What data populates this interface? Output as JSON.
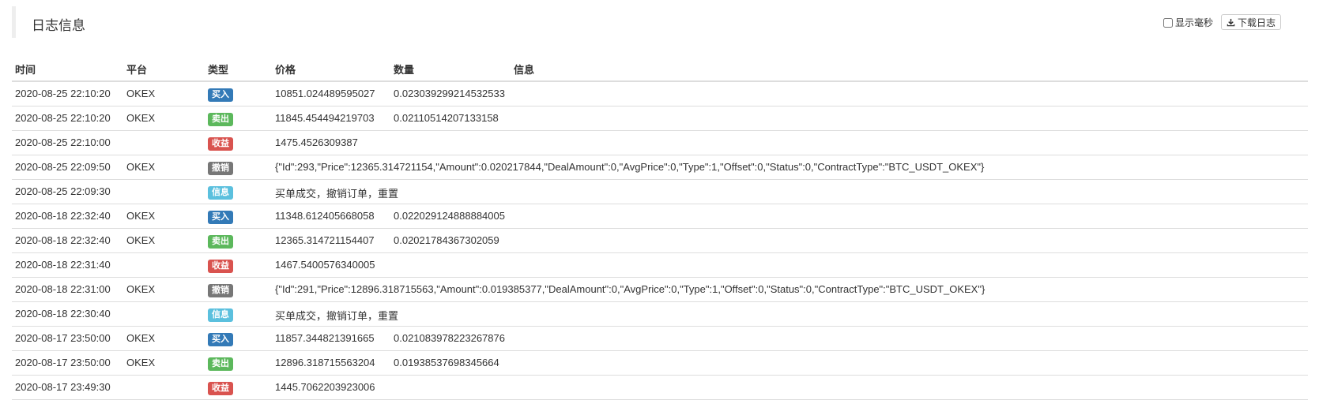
{
  "panel": {
    "title": "日志信息",
    "show_ms_label": "显示毫秒",
    "download_label": "下载日志"
  },
  "columns": {
    "time": "时间",
    "platform": "平台",
    "type": "类型",
    "price": "价格",
    "amount": "数量",
    "info": "信息"
  },
  "rows": [
    {
      "time": "2020-08-25 22:10:20",
      "platform": "OKEX",
      "type": "买入",
      "type_kind": "buy",
      "price": "10851.024489595027",
      "amount": "0.023039299214532533",
      "info": ""
    },
    {
      "time": "2020-08-25 22:10:20",
      "platform": "OKEX",
      "type": "卖出",
      "type_kind": "sell",
      "price": "11845.454494219703",
      "amount": "0.02110514207133158",
      "info": ""
    },
    {
      "time": "2020-08-25 22:10:00",
      "platform": "",
      "type": "收益",
      "type_kind": "profit",
      "price": "1475.4526309387",
      "amount": "",
      "info": ""
    },
    {
      "time": "2020-08-25 22:09:50",
      "platform": "OKEX",
      "type": "撤销",
      "type_kind": "cancel",
      "price": "{\"Id\":293,\"Price\":12365.314721154,\"Amount\":0.020217844,\"DealAmount\":0,\"AvgPrice\":0,\"Type\":1,\"Offset\":0,\"Status\":0,\"ContractType\":\"BTC_USDT_OKEX\"}",
      "amount": "",
      "info": ""
    },
    {
      "time": "2020-08-25 22:09:30",
      "platform": "",
      "type": "信息",
      "type_kind": "info",
      "price": "买单成交，撤销订单，重置",
      "amount": "",
      "info": ""
    },
    {
      "time": "2020-08-18 22:32:40",
      "platform": "OKEX",
      "type": "买入",
      "type_kind": "buy",
      "price": "11348.612405668058",
      "amount": "0.022029124888884005",
      "info": ""
    },
    {
      "time": "2020-08-18 22:32:40",
      "platform": "OKEX",
      "type": "卖出",
      "type_kind": "sell",
      "price": "12365.314721154407",
      "amount": "0.02021784367302059",
      "info": ""
    },
    {
      "time": "2020-08-18 22:31:40",
      "platform": "",
      "type": "收益",
      "type_kind": "profit",
      "price": "1467.5400576340005",
      "amount": "",
      "info": ""
    },
    {
      "time": "2020-08-18 22:31:00",
      "platform": "OKEX",
      "type": "撤销",
      "type_kind": "cancel",
      "price": "{\"Id\":291,\"Price\":12896.318715563,\"Amount\":0.019385377,\"DealAmount\":0,\"AvgPrice\":0,\"Type\":1,\"Offset\":0,\"Status\":0,\"ContractType\":\"BTC_USDT_OKEX\"}",
      "amount": "",
      "info": ""
    },
    {
      "time": "2020-08-18 22:30:40",
      "platform": "",
      "type": "信息",
      "type_kind": "info",
      "price": "买单成交，撤销订单，重置",
      "amount": "",
      "info": ""
    },
    {
      "time": "2020-08-17 23:50:00",
      "platform": "OKEX",
      "type": "买入",
      "type_kind": "buy",
      "price": "11857.344821391665",
      "amount": "0.021083978223267876",
      "info": ""
    },
    {
      "time": "2020-08-17 23:50:00",
      "platform": "OKEX",
      "type": "卖出",
      "type_kind": "sell",
      "price": "12896.318715563204",
      "amount": "0.01938537698345664",
      "info": ""
    },
    {
      "time": "2020-08-17 23:49:30",
      "platform": "",
      "type": "收益",
      "type_kind": "profit",
      "price": "1445.7062203923006",
      "amount": "",
      "info": ""
    }
  ],
  "colors": {
    "buy": "#337ab7",
    "sell": "#5cb85c",
    "profit": "#d9534f",
    "cancel": "#777777",
    "info": "#5bc0de"
  },
  "icons": {
    "download": "download-icon"
  }
}
